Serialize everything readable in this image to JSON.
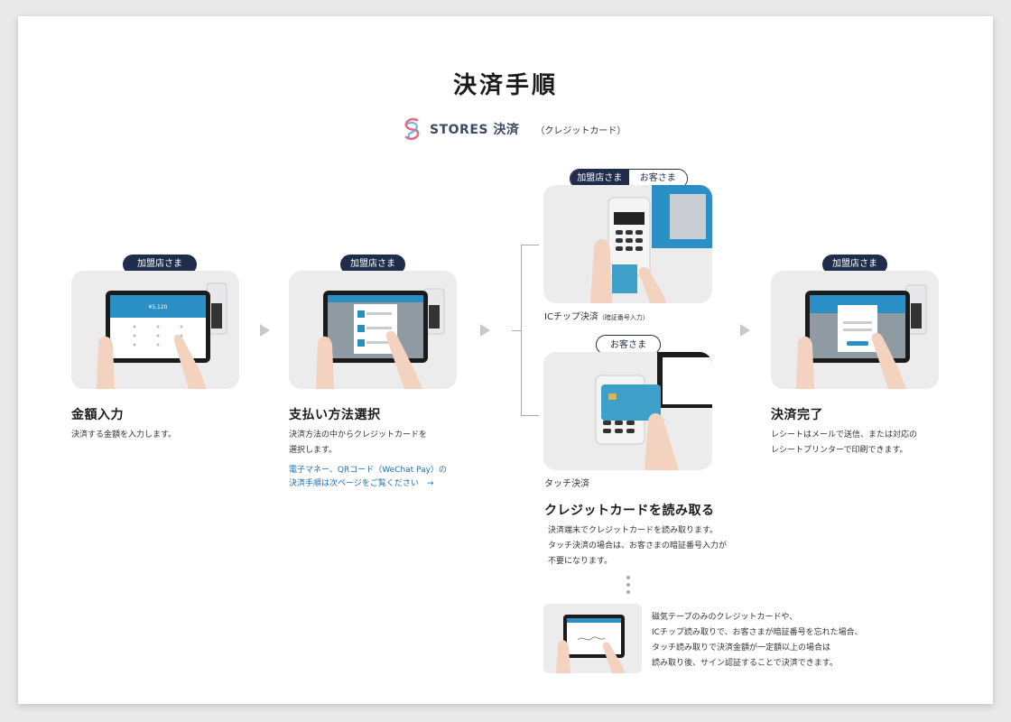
{
  "title": "決済手順",
  "brand": {
    "name": "STORES 決済",
    "sub": "（クレジットカード）"
  },
  "bubbles": {
    "merchant": "加盟店さま",
    "customer": "お客さま"
  },
  "steps": [
    {
      "title": "金額入力",
      "desc": [
        "決済する金額を入力します。"
      ]
    },
    {
      "title": "支払い方法選択",
      "desc": [
        "決済方法の中からクレジットカードを",
        "選択します。"
      ],
      "link": [
        "電子マネー、QRコード（WeChat Pay）の",
        "決済手順は次ページをご覧ください　→"
      ]
    },
    {
      "title": "クレジットカードを読み取る",
      "desc": [
        "決済端末でクレジットカードを読み取ります。",
        "タッチ決済の場合は、お客さまの暗証番号入力が",
        "不要になります。"
      ]
    },
    {
      "title": "決済完了",
      "desc": [
        "レシートはメールで送信、または対応の",
        "レシートプリンターで印刷できます。"
      ]
    }
  ],
  "captions": {
    "ic": "ICチップ決済",
    "ic_note": "（暗証番号入力）",
    "touch": "タッチ決済"
  },
  "screen": {
    "amount": "¥5,120"
  },
  "note": [
    "磁気テープのみのクレジットカードや、",
    "ICチップ読み取りで、お客さまが暗証番号を忘れた場合、",
    "タッチ読み取りで決済金額が一定額以上の場合は",
    "読み取り後、サイン認証することで決済できます。"
  ],
  "colors": {
    "navy": "#1f2c4a",
    "link": "#1f6fb5",
    "screen": "#2a8fc4",
    "card": "#3ea0c8"
  },
  "icons": [
    "stores-logo-icon",
    "triangle-arrow-icon"
  ]
}
